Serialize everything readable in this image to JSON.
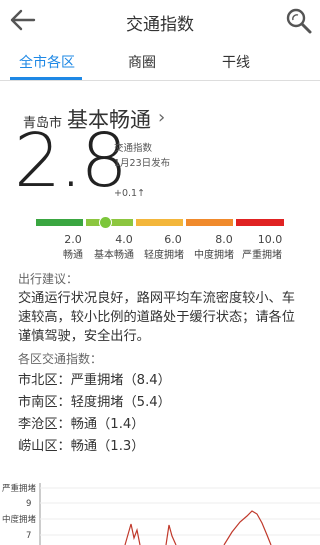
{
  "header": {
    "title": "交通指数",
    "back_icon": "arrow-left-icon",
    "search_icon": "search-icon"
  },
  "tabs": [
    {
      "label": "全市各区",
      "active": true
    },
    {
      "label": "商圈",
      "active": false
    },
    {
      "label": "干线",
      "active": false
    }
  ],
  "summary": {
    "city": "青岛市",
    "status": "基本畅通",
    "index_value": "2.8",
    "index_label": "交通指数",
    "date": "1月23日发布",
    "change": "+0.1↑",
    "gauge_level": 2.8
  },
  "scale": [
    {
      "value": "2.0",
      "label": "畅通",
      "color": "#3aa641"
    },
    {
      "value": "4.0",
      "label": "基本畅通",
      "color": "#8cc63f"
    },
    {
      "value": "6.0",
      "label": "轻度拥堵",
      "color": "#f3b63b"
    },
    {
      "value": "8.0",
      "label": "中度拥堵",
      "color": "#f08a2c"
    },
    {
      "value": "10.0",
      "label": "严重拥堵",
      "color": "#e02222"
    }
  ],
  "advice": {
    "heading": "出行建议：",
    "text": "交通运行状况良好，路网平均车流密度较小、车速较高，较小比例的道路处于缓行状态；请各位谨慎驾驶，安全出行。"
  },
  "districts": {
    "heading": "各区交通指数：",
    "items": [
      "市北区：严重拥堵（8.4）",
      "市南区：轻度拥堵（5.4）",
      "李沧区：畅通（1.4）",
      "崂山区：畅通（1.3）"
    ]
  },
  "chart": {
    "y_labels": [
      "严重拥堵",
      "9",
      "中度拥堵",
      "7"
    ]
  }
}
